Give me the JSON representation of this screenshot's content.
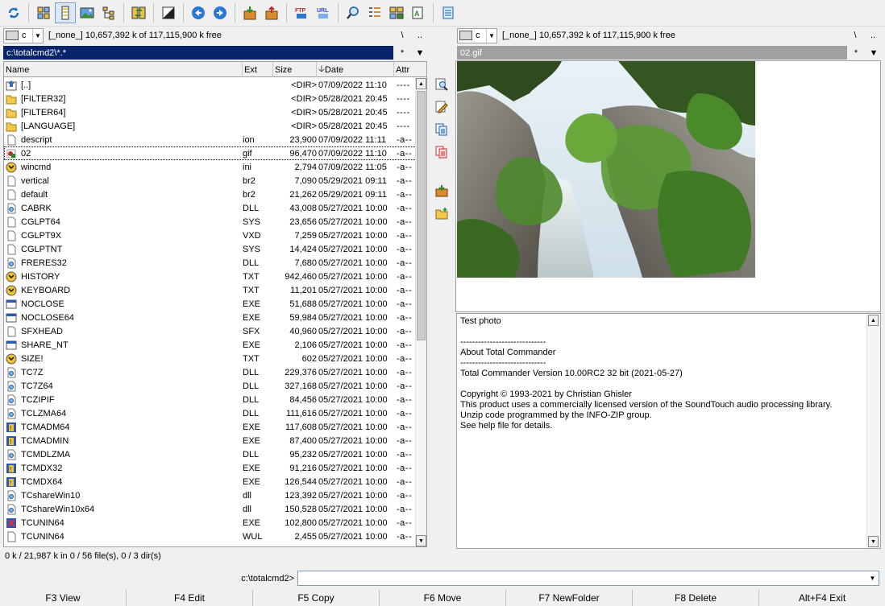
{
  "toolbar": {
    "buttons": [
      "refresh-icon",
      "brief-view-icon",
      "full-view-icon",
      "thumbnail-view-icon",
      "tree-view-icon",
      "sync-dirs-icon",
      "invert-selection-icon",
      "back-icon",
      "forward-icon",
      "pack-icon",
      "unpack-icon",
      "ftp-icon",
      "url-icon",
      "search-icon",
      "multi-rename-icon",
      "compare-icon",
      "edit-icon",
      "notepad-icon"
    ]
  },
  "left_drive": {
    "drive": "c",
    "info": "[_none_]  10,657,392 k of 117,115,900 k free",
    "root": "\\",
    "up": ".."
  },
  "right_drive": {
    "drive": "c",
    "info": "[_none_]  10,657,392 k of 117,115,900 k free",
    "root": "\\",
    "up": ".."
  },
  "left_path": {
    "text": "c:\\totalcmd2\\*.*",
    "star": "*",
    "arrow": "▼"
  },
  "right_path": {
    "text": "02.gif",
    "star": "*",
    "arrow": "▼"
  },
  "columns": {
    "name": "Name",
    "ext": "Ext",
    "size": "Size",
    "date": "Date",
    "attr": "Attr",
    "sort_arrow": "🡣"
  },
  "files": [
    {
      "icon": "up",
      "name": "[..]",
      "ext": "",
      "size": "<DIR>",
      "date": "07/09/2022 11:10",
      "attr": "----"
    },
    {
      "icon": "folder",
      "name": "[FILTER32]",
      "ext": "",
      "size": "<DIR>",
      "date": "05/28/2021 20:45",
      "attr": "----"
    },
    {
      "icon": "folder",
      "name": "[FILTER64]",
      "ext": "",
      "size": "<DIR>",
      "date": "05/28/2021 20:45",
      "attr": "----"
    },
    {
      "icon": "folder",
      "name": "[LANGUAGE]",
      "ext": "",
      "size": "<DIR>",
      "date": "05/28/2021 20:45",
      "attr": "----"
    },
    {
      "icon": "file",
      "name": "descript",
      "ext": "ion",
      "size": "23,900",
      "date": "07/09/2022 11:11",
      "attr": "-a--"
    },
    {
      "icon": "gif",
      "name": "02",
      "ext": "gif",
      "size": "96,470",
      "date": "07/09/2022 11:10",
      "attr": "-a--"
    },
    {
      "icon": "ini",
      "name": "wincmd",
      "ext": "ini",
      "size": "2,794",
      "date": "07/09/2022 11:05",
      "attr": "-a--"
    },
    {
      "icon": "file",
      "name": "vertical",
      "ext": "br2",
      "size": "7,090",
      "date": "05/29/2021 09:11",
      "attr": "-a--"
    },
    {
      "icon": "file",
      "name": "default",
      "ext": "br2",
      "size": "21,262",
      "date": "05/29/2021 09:11",
      "attr": "-a--"
    },
    {
      "icon": "dll",
      "name": "CABRK",
      "ext": "DLL",
      "size": "43,008",
      "date": "05/27/2021 10:00",
      "attr": "-a--"
    },
    {
      "icon": "file",
      "name": "CGLPT64",
      "ext": "SYS",
      "size": "23,656",
      "date": "05/27/2021 10:00",
      "attr": "-a--"
    },
    {
      "icon": "file",
      "name": "CGLPT9X",
      "ext": "VXD",
      "size": "7,259",
      "date": "05/27/2021 10:00",
      "attr": "-a--"
    },
    {
      "icon": "file",
      "name": "CGLPTNT",
      "ext": "SYS",
      "size": "14,424",
      "date": "05/27/2021 10:00",
      "attr": "-a--"
    },
    {
      "icon": "dll",
      "name": "FRERES32",
      "ext": "DLL",
      "size": "7,680",
      "date": "05/27/2021 10:00",
      "attr": "-a--"
    },
    {
      "icon": "ini",
      "name": "HISTORY",
      "ext": "TXT",
      "size": "942,460",
      "date": "05/27/2021 10:00",
      "attr": "-a--"
    },
    {
      "icon": "ini",
      "name": "KEYBOARD",
      "ext": "TXT",
      "size": "11,201",
      "date": "05/27/2021 10:00",
      "attr": "-a--"
    },
    {
      "icon": "exe",
      "name": "NOCLOSE",
      "ext": "EXE",
      "size": "51,688",
      "date": "05/27/2021 10:00",
      "attr": "-a--"
    },
    {
      "icon": "exe",
      "name": "NOCLOSE64",
      "ext": "EXE",
      "size": "59,984",
      "date": "05/27/2021 10:00",
      "attr": "-a--"
    },
    {
      "icon": "file",
      "name": "SFXHEAD",
      "ext": "SFX",
      "size": "40,960",
      "date": "05/27/2021 10:00",
      "attr": "-a--"
    },
    {
      "icon": "exe",
      "name": "SHARE_NT",
      "ext": "EXE",
      "size": "2,106",
      "date": "05/27/2021 10:00",
      "attr": "-a--"
    },
    {
      "icon": "ini",
      "name": "SIZE!",
      "ext": "TXT",
      "size": "602",
      "date": "05/27/2021 10:00",
      "attr": "-a--"
    },
    {
      "icon": "dll",
      "name": "TC7Z",
      "ext": "DLL",
      "size": "229,376",
      "date": "05/27/2021 10:00",
      "attr": "-a--"
    },
    {
      "icon": "dll",
      "name": "TC7Z64",
      "ext": "DLL",
      "size": "327,168",
      "date": "05/27/2021 10:00",
      "attr": "-a--"
    },
    {
      "icon": "dll",
      "name": "TCZIPIF",
      "ext": "DLL",
      "size": "84,456",
      "date": "05/27/2021 10:00",
      "attr": "-a--"
    },
    {
      "icon": "dll",
      "name": "TCLZMA64",
      "ext": "DLL",
      "size": "111,616",
      "date": "05/27/2021 10:00",
      "attr": "-a--"
    },
    {
      "icon": "tcexe",
      "name": "TCMADM64",
      "ext": "EXE",
      "size": "117,608",
      "date": "05/27/2021 10:00",
      "attr": "-a--"
    },
    {
      "icon": "tcexe",
      "name": "TCMADMIN",
      "ext": "EXE",
      "size": "87,400",
      "date": "05/27/2021 10:00",
      "attr": "-a--"
    },
    {
      "icon": "dll",
      "name": "TCMDLZMA",
      "ext": "DLL",
      "size": "95,232",
      "date": "05/27/2021 10:00",
      "attr": "-a--"
    },
    {
      "icon": "tcexe",
      "name": "TCMDX32",
      "ext": "EXE",
      "size": "91,216",
      "date": "05/27/2021 10:00",
      "attr": "-a--"
    },
    {
      "icon": "tcexe",
      "name": "TCMDX64",
      "ext": "EXE",
      "size": "126,544",
      "date": "05/27/2021 10:00",
      "attr": "-a--"
    },
    {
      "icon": "dll",
      "name": "TCshareWin10",
      "ext": "dll",
      "size": "123,392",
      "date": "05/27/2021 10:00",
      "attr": "-a--"
    },
    {
      "icon": "dll",
      "name": "TCshareWin10x64",
      "ext": "dll",
      "size": "150,528",
      "date": "05/27/2021 10:00",
      "attr": "-a--"
    },
    {
      "icon": "uninst",
      "name": "TCUNIN64",
      "ext": "EXE",
      "size": "102,800",
      "date": "05/27/2021 10:00",
      "attr": "-a--"
    },
    {
      "icon": "file",
      "name": "TCUNIN64",
      "ext": "WUL",
      "size": "2,455",
      "date": "05/27/2021 10:00",
      "attr": "-a--"
    }
  ],
  "cursor_row": 5,
  "viewer": {
    "lines": [
      "Test photo",
      "",
      "-----------------------------",
      "About Total Commander",
      "-----------------------------",
      "Total Commander Version 10.00RC2 32 bit (2021-05-27)",
      "",
      "Copyright © 1993-2021 by Christian Ghisler",
      "This product uses a commercially licensed version of the SoundTouch audio processing library.",
      "Unzip code programmed by the INFO-ZIP group.",
      "See help file for details."
    ]
  },
  "status": "0 k / 21,987 k in 0 / 56 file(s), 0 / 3 dir(s)",
  "command": {
    "label": "c:\\totalcmd2>",
    "value": ""
  },
  "fkeys": [
    "F3 View",
    "F4 Edit",
    "F5 Copy",
    "F6 Move",
    "F7 NewFolder",
    "F8 Delete",
    "Alt+F4 Exit"
  ],
  "colors": {
    "active_path": "#0a246a",
    "inactive_path": "#a0a0a0",
    "panel_bg": "#ffffff",
    "chrome": "#f0f0f0"
  }
}
